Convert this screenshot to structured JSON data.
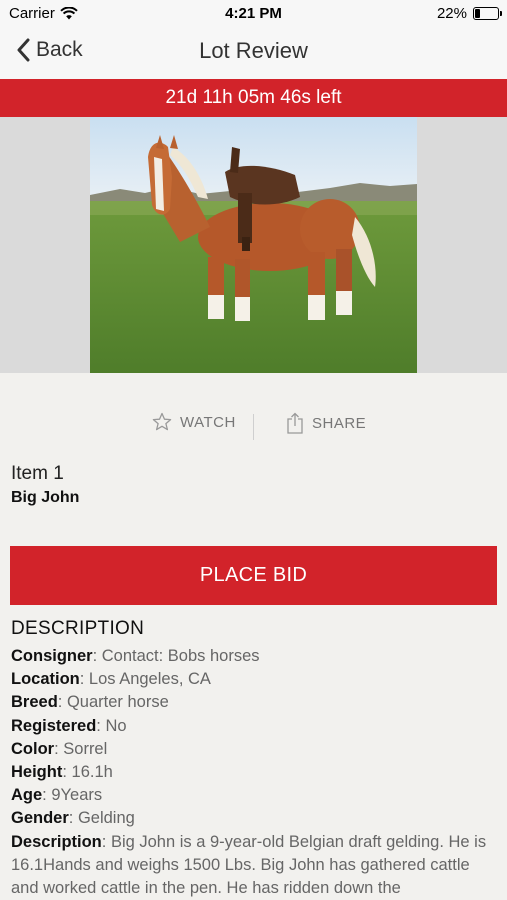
{
  "status_bar": {
    "carrier": "Carrier",
    "time": "4:21 PM",
    "battery_percent": "22%",
    "battery_level": 0.22,
    "wifi_icon": "wifi-icon"
  },
  "nav": {
    "back_label": "Back",
    "title": "Lot Review"
  },
  "timer": {
    "text": "21d 11h 05m 46s left"
  },
  "actions": {
    "watch_label": "WATCH",
    "share_label": "SHARE"
  },
  "item": {
    "number": "Item 1",
    "name": "Big John"
  },
  "bid_button_label": "PLACE BID",
  "description": {
    "heading": "DESCRIPTION",
    "fields": [
      {
        "key": "Consigner",
        "value": "Contact: Bobs horses"
      },
      {
        "key": "Location",
        "value": "Los Angeles, CA"
      },
      {
        "key": "Breed",
        "value": "Quarter horse"
      },
      {
        "key": "Registered",
        "value": "No"
      },
      {
        "key": "Color",
        "value": "Sorrel"
      },
      {
        "key": "Height",
        "value": "16.1h"
      },
      {
        "key": "Age",
        "value": "9Years"
      },
      {
        "key": "Gender",
        "value": "Gelding"
      },
      {
        "key": "Description",
        "value": "Big John is a 9-year-old Belgian draft gelding. He is 16.1Hands and weighs 1500 Lbs. Big John has gathered cattle and worked cattle in the pen. He has ridden down the"
      }
    ]
  },
  "colors": {
    "accent_red": "#d2232a",
    "background": "#f2f1ee"
  }
}
